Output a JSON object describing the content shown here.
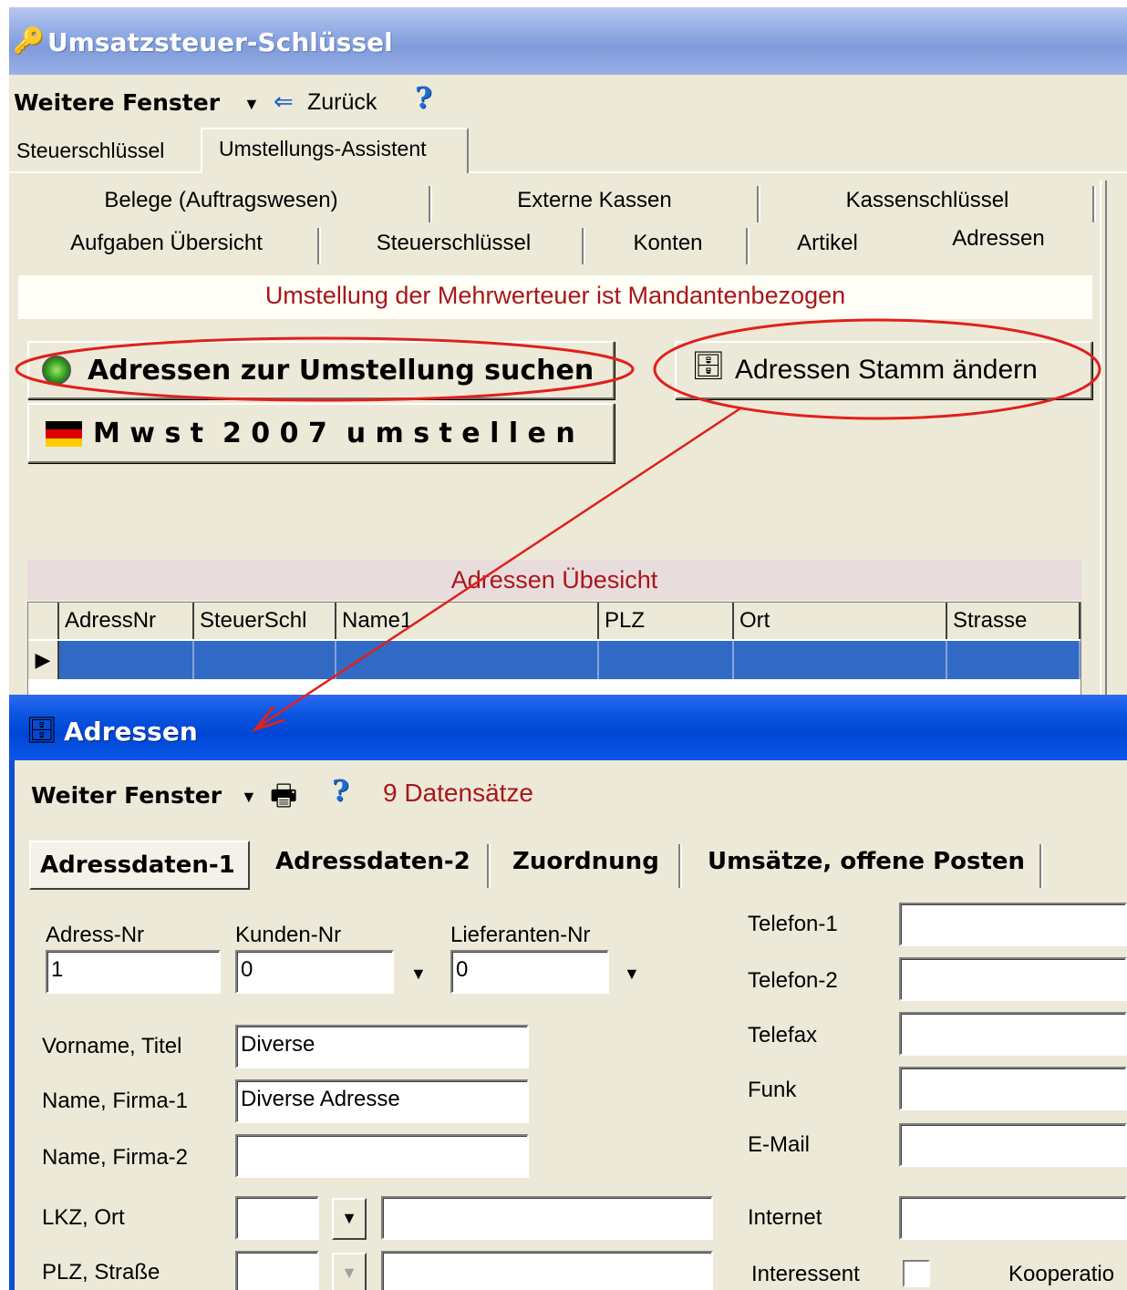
{
  "back_window": {
    "title": "Umsatzsteuer-Schlüssel",
    "toolbar": {
      "menu_label": "Weitere Fenster",
      "back_label": "Zurück",
      "help": "?"
    },
    "top_tabs": [
      "Steuerschlüssel",
      "Umstellungs-Assistent"
    ],
    "tab_row1": [
      "Belege (Auftragswesen)",
      "Externe Kassen",
      "Kassenschlüssel"
    ],
    "tab_row2": [
      "Aufgaben Übersicht",
      "Steuerschlüssel",
      "Konten",
      "Artikel",
      "Adressen"
    ],
    "info_banner": "Umstellung der Mehrwerteuer ist Mandantenbezogen",
    "search_button": "Adressen zur Umstellung suchen",
    "change_button": "Adressen Stamm ändern",
    "mwst_button": "M w s t  2 0 0 7  u m s t e l l e n",
    "grid": {
      "title": "Adressen Übesicht",
      "columns": [
        "AdressNr",
        "SteuerSchl",
        "Name1",
        "PLZ",
        "Ort",
        "Strasse"
      ]
    }
  },
  "front_window": {
    "title": "Adressen",
    "toolbar": {
      "menu_label": "Weiter Fenster",
      "help": "?",
      "record_count": "9 Datensätze"
    },
    "tabs": [
      "Adressdaten-1",
      "Adressdaten-2",
      "Zuordnung",
      "Umsätze, offene Posten"
    ],
    "fields": {
      "adress_nr": {
        "label": "Adress-Nr",
        "value": "1"
      },
      "kunden_nr": {
        "label": "Kunden-Nr",
        "value": "0"
      },
      "lieferanten_nr": {
        "label": "Lieferanten-Nr",
        "value": "0"
      },
      "vorname": {
        "label": "Vorname, Titel",
        "value": "Diverse"
      },
      "name1": {
        "label": "Name, Firma-1",
        "value": "Diverse Adresse"
      },
      "name2": {
        "label": "Name, Firma-2",
        "value": ""
      },
      "lkz_ort": {
        "label": "LKZ, Ort",
        "value": ""
      },
      "plz_strasse": {
        "label": "PLZ, Straße",
        "value": ""
      },
      "telefon1": {
        "label": "Telefon-1",
        "value": ""
      },
      "telefon2": {
        "label": "Telefon-2",
        "value": ""
      },
      "telefax": {
        "label": "Telefax",
        "value": ""
      },
      "funk": {
        "label": "Funk",
        "value": ""
      },
      "email": {
        "label": "E-Mail",
        "value": ""
      },
      "internet": {
        "label": "Internet",
        "value": ""
      },
      "interessent": {
        "label": "Interessent",
        "checked": false
      },
      "kooperation": {
        "label": "Kooperatio"
      }
    }
  },
  "colors": {
    "annotation_red": "#e0201c",
    "banner_text": "#a8161a",
    "grid_selected": "#316ac5",
    "xp_blue_title": "#0a55e0"
  }
}
